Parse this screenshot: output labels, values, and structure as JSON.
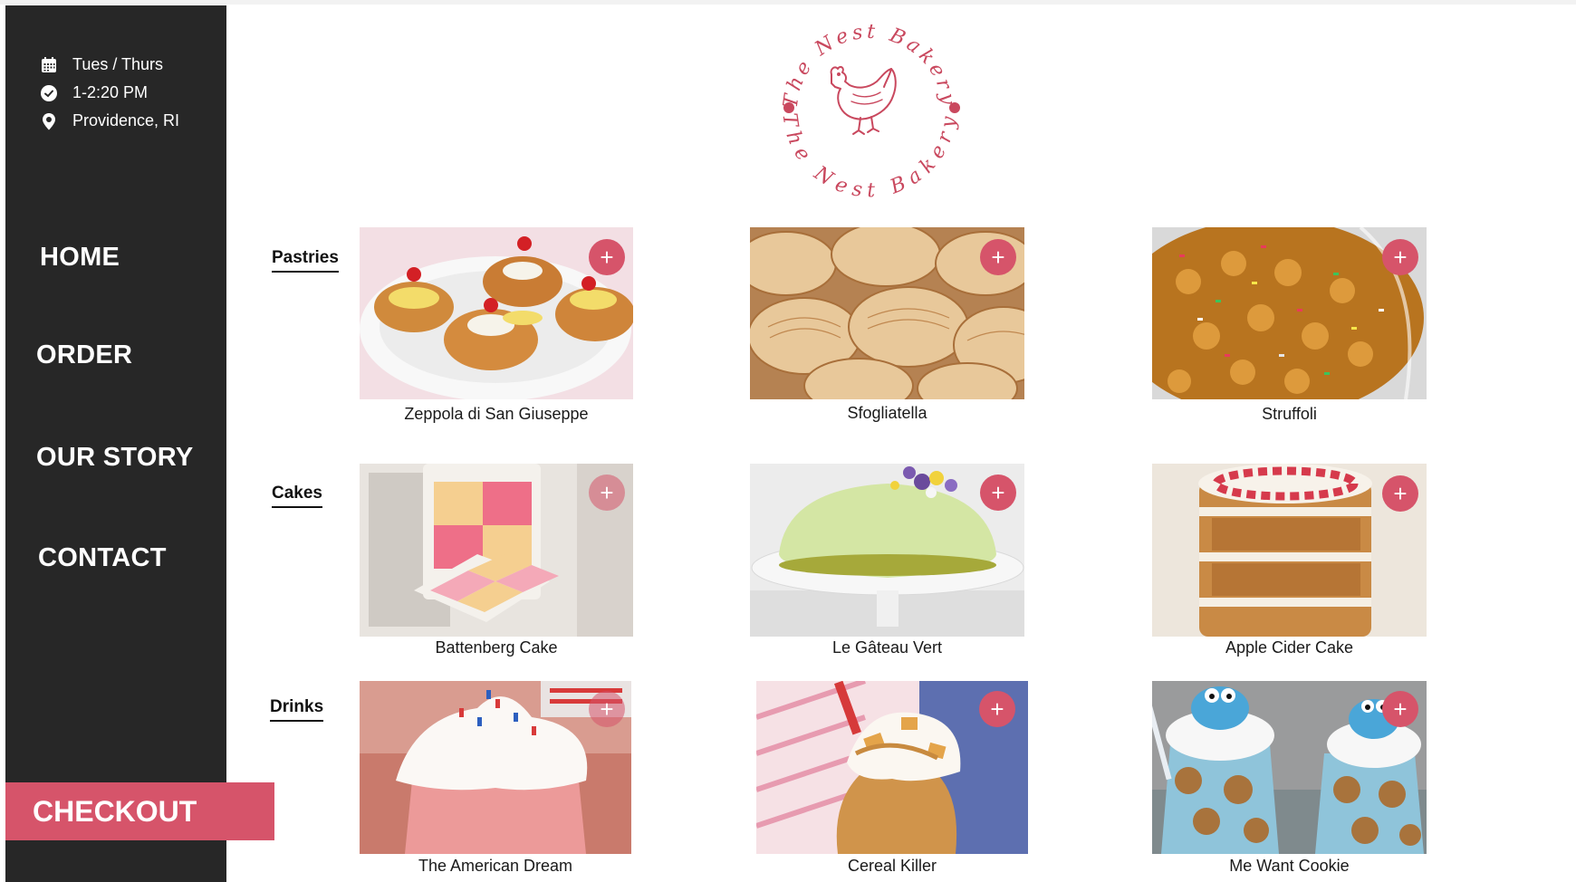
{
  "sidebar": {
    "info": [
      {
        "icon": "calendar-icon",
        "text": "Tues / Thurs"
      },
      {
        "icon": "clock-icon",
        "text": "1-2:20 PM"
      },
      {
        "icon": "location-pin-icon",
        "text": "Providence, RI"
      }
    ],
    "nav": [
      "HOME",
      "ORDER",
      "OUR STORY",
      "CONTACT"
    ],
    "checkout": "CHECKOUT"
  },
  "logo": {
    "top_text": "The Nest Bakery",
    "bottom_text": "The Nest Bakery",
    "icon": "hen-icon"
  },
  "menu": {
    "add_icon": "plus-icon",
    "sections": [
      {
        "label": "Pastries",
        "items": [
          "Zeppola di San Giuseppe",
          "Sfogliatella",
          "Struffoli"
        ]
      },
      {
        "label": "Cakes",
        "items": [
          "Battenberg Cake",
          "Le Gâteau Vert",
          "Apple Cider Cake"
        ]
      },
      {
        "label": "Drinks",
        "items": [
          "The American Dream",
          "Cereal Killer",
          "Me Want Cookie"
        ]
      }
    ]
  },
  "colors": {
    "accent": "#d6546a",
    "sidebar": "#272727"
  }
}
